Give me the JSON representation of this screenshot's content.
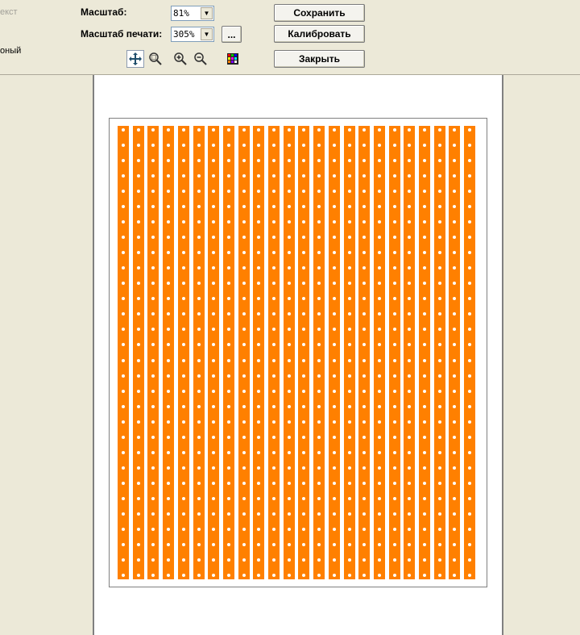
{
  "left_panel": {
    "text_option": "екст",
    "other_option": "оный"
  },
  "scale": {
    "label": "Масштаб:",
    "value": "81%"
  },
  "print_scale": {
    "label": "Масштаб печати:",
    "value": "305%",
    "more_label": "..."
  },
  "buttons": {
    "save": "Сохранить",
    "calibrate": "Калибровать",
    "close": "Закрыть"
  },
  "tools": [
    "move-icon",
    "zoom-area-icon",
    "zoom-in-icon",
    "zoom-out-icon",
    "color-palette-icon"
  ],
  "preview": {
    "strip_color": "#FF8000",
    "strip_count": 24,
    "holes_per_strip": 30
  }
}
